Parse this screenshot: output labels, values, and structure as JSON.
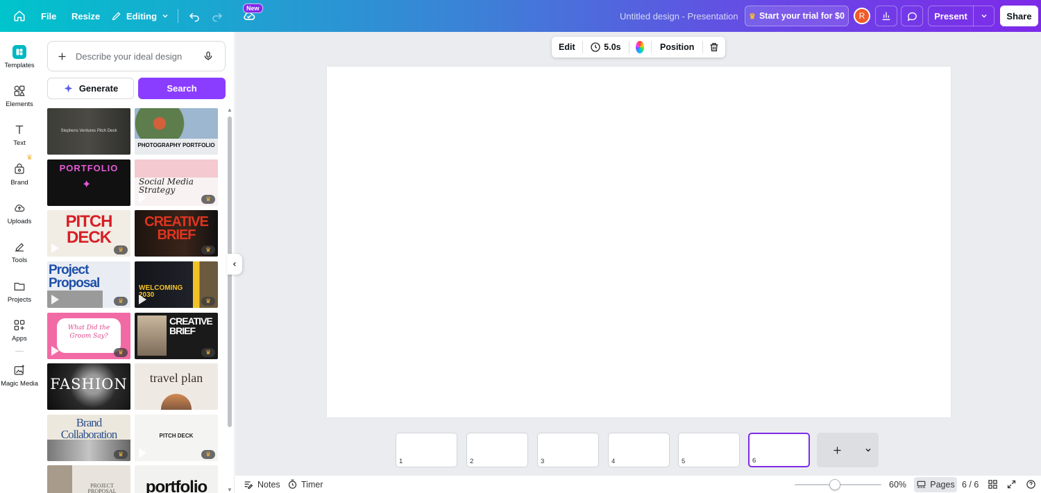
{
  "topbar": {
    "file_label": "File",
    "resize_label": "Resize",
    "editing_label": "Editing",
    "new_badge": "New",
    "doc_title": "Untitled design - Presentation",
    "trial_label": "Start your trial for $0",
    "avatar_initial": "R",
    "present_label": "Present",
    "share_label": "Share",
    "gradient_colors": [
      "#00c4cc",
      "#7d2ae8"
    ]
  },
  "rail": {
    "items": [
      {
        "label": "Templates",
        "icon": "templates-icon"
      },
      {
        "label": "Elements",
        "icon": "elements-icon"
      },
      {
        "label": "Text",
        "icon": "text-icon"
      },
      {
        "label": "Brand",
        "icon": "brand-icon"
      },
      {
        "label": "Uploads",
        "icon": "uploads-icon"
      },
      {
        "label": "Tools",
        "icon": "tools-icon"
      },
      {
        "label": "Projects",
        "icon": "projects-icon"
      },
      {
        "label": "Apps",
        "icon": "apps-icon"
      },
      {
        "label": "Magic Media",
        "icon": "magic-media-icon"
      }
    ]
  },
  "panel": {
    "search_placeholder": "Describe your ideal design",
    "generate_label": "Generate",
    "search_label": "Search",
    "accent": "#8b3dff",
    "templates": [
      {
        "title": "Stephens Ventures Pitch Deck"
      },
      {
        "title": "PHOTOGRAPHY PORTFOLIO"
      },
      {
        "title": "PORTFOLIO"
      },
      {
        "title": "Social Media Strategy"
      },
      {
        "title": "PITCH DECK"
      },
      {
        "title": "CREATIVE BRIEF"
      },
      {
        "title": "Project Proposal"
      },
      {
        "title": "WELCOMING 2030"
      },
      {
        "title": "What Did the Groom Say?"
      },
      {
        "title": "CREATIVE BRIEF"
      },
      {
        "title": "FASHION"
      },
      {
        "title": "travel plan"
      },
      {
        "title": "Brand Collaboration"
      },
      {
        "title": "PITCH DECK"
      },
      {
        "title": "PROJECT PROPOSAL"
      },
      {
        "title": "portfolio"
      }
    ]
  },
  "toolbar": {
    "edit_label": "Edit",
    "duration": "5.0s",
    "position_label": "Position"
  },
  "pages": {
    "thumbs": [
      "1",
      "2",
      "3",
      "4",
      "5",
      "6"
    ],
    "active": 6
  },
  "footer": {
    "notes_label": "Notes",
    "timer_label": "Timer",
    "zoom": "60%",
    "pages_label": "Pages",
    "page_counter": "6 / 6"
  }
}
